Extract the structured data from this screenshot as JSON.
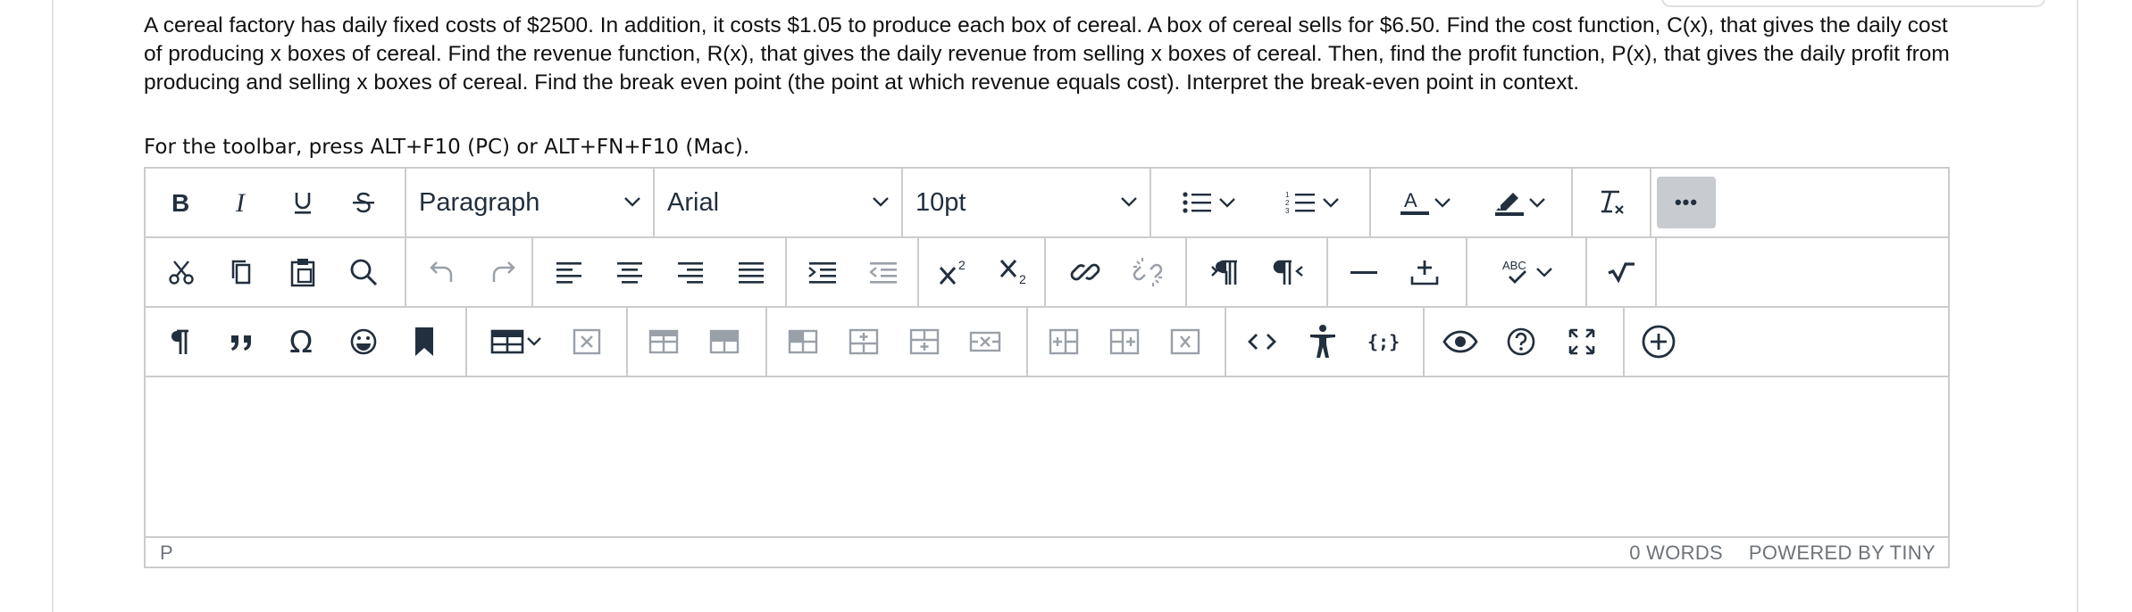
{
  "question": {
    "text": "A cereal factory has daily fixed costs of $2500. In addition, it costs $1.05 to produce each box of cereal. A box of cereal sells for $6.50. Find the cost function, C(x), that gives the daily cost of producing x boxes of cereal. Find the revenue function, R(x), that gives the daily revenue from selling x boxes of cereal. Then, find the profit function, P(x), that gives the daily profit from producing and selling x boxes of cereal. Find the break even point (the point at which revenue equals cost). Interpret the break-even point in context."
  },
  "toolbar_hint": "For the toolbar, press ALT+F10 (PC) or ALT+FN+F10 (Mac).",
  "toolbar": {
    "block_format": "Paragraph",
    "font_family": "Arial",
    "font_size": "10pt",
    "more_label": "•••"
  },
  "statusbar": {
    "path": "P",
    "word_count": "0 WORDS",
    "branding": "POWERED BY TINY"
  },
  "colors": {
    "icon": "#222f3e",
    "border": "#cccccc",
    "active_bg": "#c8cbcf",
    "disabled_icon": "#9aa0a8",
    "status_text": "#6d737a"
  }
}
